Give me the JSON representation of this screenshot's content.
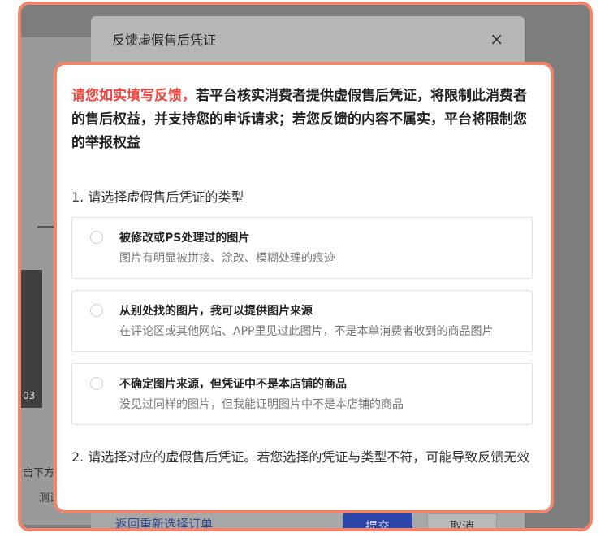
{
  "background": {
    "time_label": "03",
    "text_1": "击下方",
    "text_2": "测试"
  },
  "under_dialog": {
    "title": "反馈虚假售后凭证",
    "close_glyph": "×",
    "back_link": "返回重新选择订单",
    "submit_label": "提交",
    "cancel_label": "取消"
  },
  "popup": {
    "notice_red": "请您如实填写反馈，",
    "notice_rest": "若平台核实消费者提供虚假售后凭证，将限制此消费者的售后权益，并支持您的申诉请求；若您反馈的内容不属实，平台将限制您的举报权益",
    "q1_title": "1. 请选择虚假售后凭证的类型",
    "options": [
      {
        "title": "被修改或PS处理过的图片",
        "desc": "图片有明显被拼接、涂改、模糊处理的痕迹"
      },
      {
        "title": "从别处找的图片，我可以提供图片来源",
        "desc": "在评论区或其他网站、APP里见过此图片，不是本单消费者收到的商品图片"
      },
      {
        "title": "不确定图片来源，但凭证中不是本店铺的商品",
        "desc": "没见过同样的图片，但我能证明图片中不是本店铺的商品"
      }
    ],
    "q2_title": "2. 请选择对应的虚假售后凭证。若您选择的凭证与类型不符，可能导致反馈无效"
  },
  "colors": {
    "accent_border": "#f1846c",
    "notice_red": "#f2453d",
    "submit_blue": "#2d47a8"
  }
}
